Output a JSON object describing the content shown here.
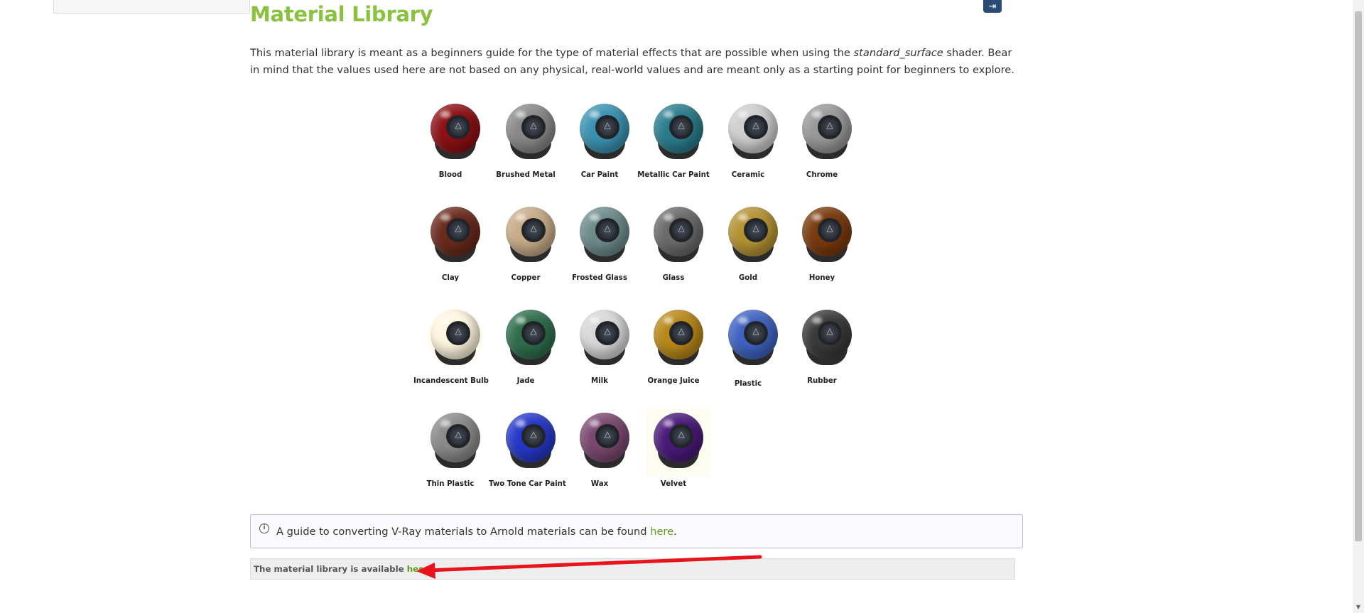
{
  "header": {
    "title": "Material Library",
    "exit_icon": "exit-icon"
  },
  "intro": {
    "text_before": "This material library is meant as a beginners guide for the type of material effects that are possible when using the ",
    "shader_name": "standard_surface",
    "text_after": " shader. Bear in mind that the values used here are not based on any physical, real-world values and are meant only as a starting point for beginners to explore."
  },
  "materials": [
    {
      "label": "Blood",
      "color": "#8e1014"
    },
    {
      "label": "Brushed Metal",
      "color": "#8a8a8a"
    },
    {
      "label": "Car Paint",
      "color": "#3a93b3"
    },
    {
      "label": "Metallic Car Paint",
      "color": "#2a7d8e"
    },
    {
      "label": "Ceramic",
      "color": "#cfcfcf"
    },
    {
      "label": "Chrome",
      "color": "#9a9a9a"
    },
    {
      "label": "Clay",
      "color": "#6a2a1c"
    },
    {
      "label": "Copper",
      "color": "#c9ad8a"
    },
    {
      "label": "Frosted Glass",
      "color": "#6d8c8c"
    },
    {
      "label": "Glass",
      "color": "#6b6b6b"
    },
    {
      "label": "Gold",
      "color": "#b59334"
    },
    {
      "label": "Honey",
      "color": "#7a3a0c"
    },
    {
      "label": "Incandescent Bulb",
      "color": "#fff7e0"
    },
    {
      "label": "Jade",
      "color": "#2e6e4d"
    },
    {
      "label": "Milk",
      "color": "#d9d9d9"
    },
    {
      "label": "Orange Juice",
      "color": "#b98819"
    },
    {
      "label": "Plastic",
      "color": "#3f63c2"
    },
    {
      "label": "Rubber",
      "color": "#3a3a3a"
    },
    {
      "label": "Thin Plastic",
      "color": "#8b8b8b"
    },
    {
      "label": "Two Tone Car Paint",
      "color": "#2638c9"
    },
    {
      "label": "Wax",
      "color": "#7b4870"
    },
    {
      "label": "Velvet",
      "color": "#4a1a7a"
    }
  ],
  "info": {
    "icon": "info-icon",
    "text": "A guide to converting V-Ray materials to Arnold materials can be found ",
    "link": "here",
    "after": "."
  },
  "note": {
    "text": "The material library is available ",
    "link": "here",
    "after": "."
  },
  "annotation": {
    "arrow_color": "#e8131b"
  }
}
